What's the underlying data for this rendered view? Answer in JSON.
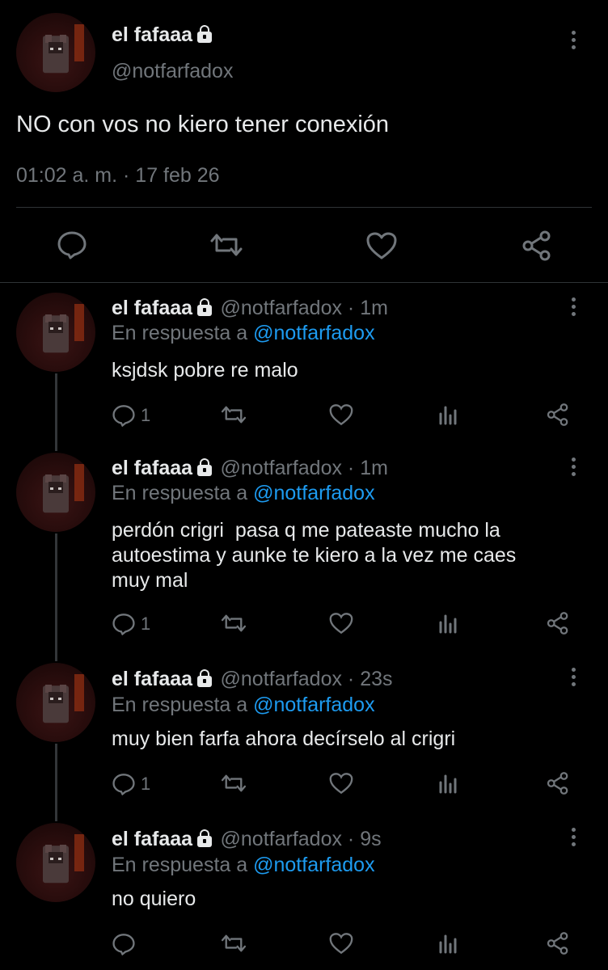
{
  "main_tweet": {
    "display_name": "el fafaaa",
    "handle": "@notfarfadox",
    "text": "NO con vos no kiero tener conexión",
    "timestamp": "01:02 a. m. · 17 feb 26"
  },
  "replies": [
    {
      "display_name": "el fafaaa",
      "handle_time": "@notfarfadox · 1m",
      "reply_prefix": "En respuesta a",
      "reply_mention": "@notfarfadox",
      "text": "ksjdsk pobre re malo",
      "reply_count": "1"
    },
    {
      "display_name": "el fafaaa",
      "handle_time": "@notfarfadox · 1m",
      "reply_prefix": "En respuesta a",
      "reply_mention": "@notfarfadox",
      "text_lines": [
        "perdón crigri  pasa q me pateaste mucho la",
        "autoestima y aunke te kiero a la vez me caes",
        "muy mal"
      ],
      "reply_count": "1"
    },
    {
      "display_name": "el fafaaa",
      "handle_time": "@notfarfadox · 23s",
      "reply_prefix": "En respuesta a",
      "reply_mention": "@notfarfadox",
      "text": "muy bien farfa ahora decírselo al crigri",
      "reply_count": "1"
    },
    {
      "display_name": "el fafaaa",
      "handle_time": "@notfarfadox · 9s",
      "reply_prefix": "En respuesta a",
      "reply_mention": "@notfarfadox",
      "text": "no quiero",
      "reply_count": ""
    }
  ],
  "icons": {
    "reply": "reply-icon",
    "retweet": "retweet-icon",
    "like": "heart-icon",
    "views": "views-icon",
    "share": "share-icon",
    "lock": "lock-icon",
    "more": "more-icon"
  },
  "colors": {
    "background": "#000000",
    "text": "#e7e9ea",
    "muted": "#71767b",
    "link": "#1d9bf0"
  }
}
